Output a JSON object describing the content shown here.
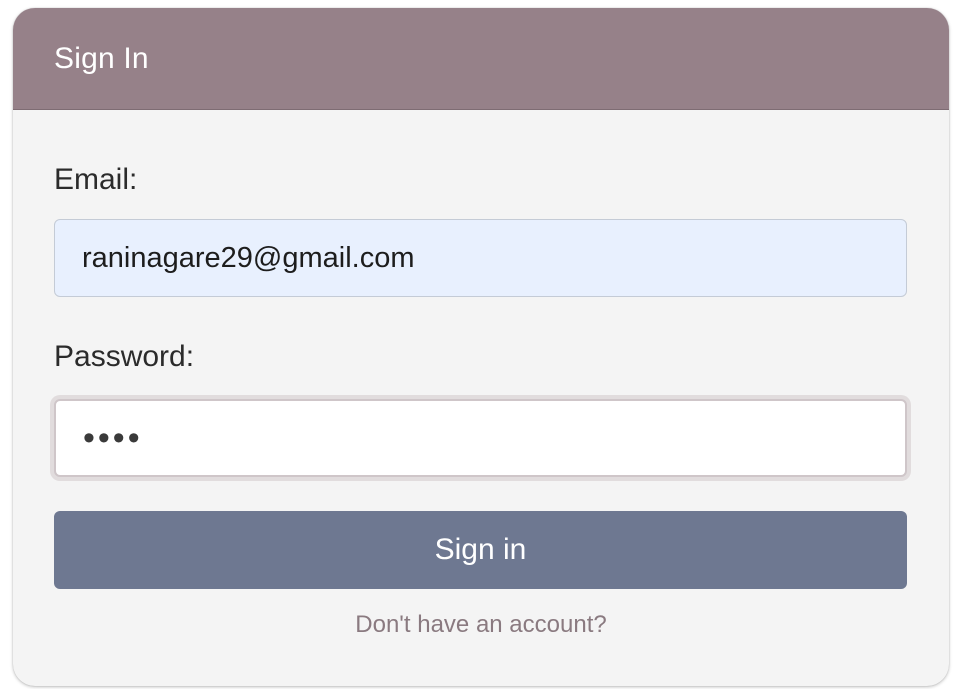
{
  "colors": {
    "header_bg": "#968189",
    "card_bg": "#f4f4f4",
    "email_field_bg": "#e8f0fe",
    "button_bg": "#6e7891",
    "link_color": "#8a7a80"
  },
  "header": {
    "title": "Sign In"
  },
  "form": {
    "email_label": "Email:",
    "email_value": "raninagare29@gmail.com",
    "password_label": "Password:",
    "password_masked": "••••",
    "submit_label": "Sign in",
    "account_link": "Don't have an account?"
  }
}
